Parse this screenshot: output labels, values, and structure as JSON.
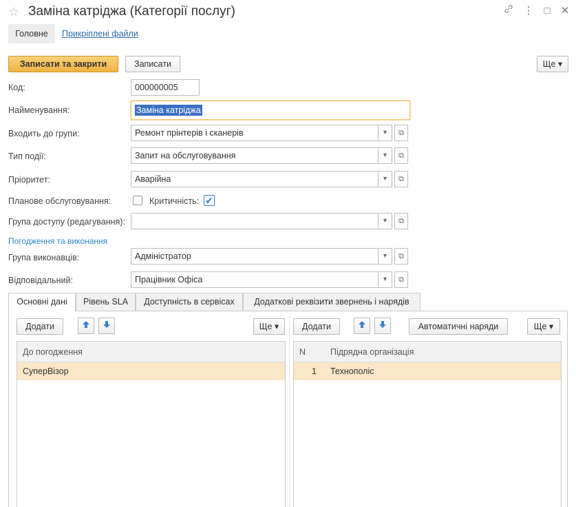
{
  "window": {
    "title": "Заміна катріджа (Категорії послуг)",
    "star": "☆",
    "link_icon": "🔗",
    "menu_icon": "⋮",
    "maximize_icon": "□",
    "close_icon": "✕"
  },
  "nav": {
    "main": "Головне",
    "attached": "Прикріплені файли"
  },
  "toolbar": {
    "save_close": "Записати та закрити",
    "save": "Записати",
    "more": "Ще ▾"
  },
  "form": {
    "code_label": "Код:",
    "code_value": "000000005",
    "name_label": "Найменування:",
    "name_value": "Заміна катріджа",
    "group_label": "Входить до групи:",
    "group_value": "Ремонт прінтерів і сканерів",
    "event_type_label": "Тип події:",
    "event_type_value": "Запит на обслуговування",
    "priority_label": "Пріоритет:",
    "priority_value": "Аварійна",
    "planned_label": "Планове обслуговування:",
    "planned_checked": false,
    "critical_label": "Критичність:",
    "critical_checked": true,
    "access_group_label": "Група доступу (редагування):",
    "access_group_value": "",
    "section_approval": "Погодження та виконання",
    "executors_label": "Група виконавців:",
    "executors_value": "Адміністратор",
    "responsible_label": "Відповідальний:",
    "responsible_value": "Працівник Офіса"
  },
  "tabs": [
    {
      "label": "Основні дані",
      "active": true
    },
    {
      "label": "Рівень SLA",
      "active": false
    },
    {
      "label": "Доступність в сервісах",
      "active": false
    },
    {
      "label": "Додаткові реквізити звернень і нарядів",
      "active": false
    }
  ],
  "left_panel": {
    "add": "Додати",
    "up_icon": "🡅",
    "down_icon": "🡇",
    "more": "Ще ▾",
    "column": "До погодження",
    "rows": [
      "СуперВізор"
    ]
  },
  "right_panel": {
    "add": "Додати",
    "up_icon": "🡅",
    "down_icon": "🡇",
    "auto_orders": "Автоматичні наряди",
    "more": "Ще ▾",
    "col_n": "N",
    "col_org": "Підрядна організація",
    "rows": [
      {
        "n": "1",
        "org": "Технополіс"
      }
    ]
  },
  "icons": {
    "dropdown": "▾",
    "open": "⧉",
    "check": "✔"
  },
  "colors": {
    "primary_button": "#f0b343",
    "link": "#2b6cb0",
    "selection_row": "#fbe6c7",
    "check": "#2f7fd0"
  }
}
